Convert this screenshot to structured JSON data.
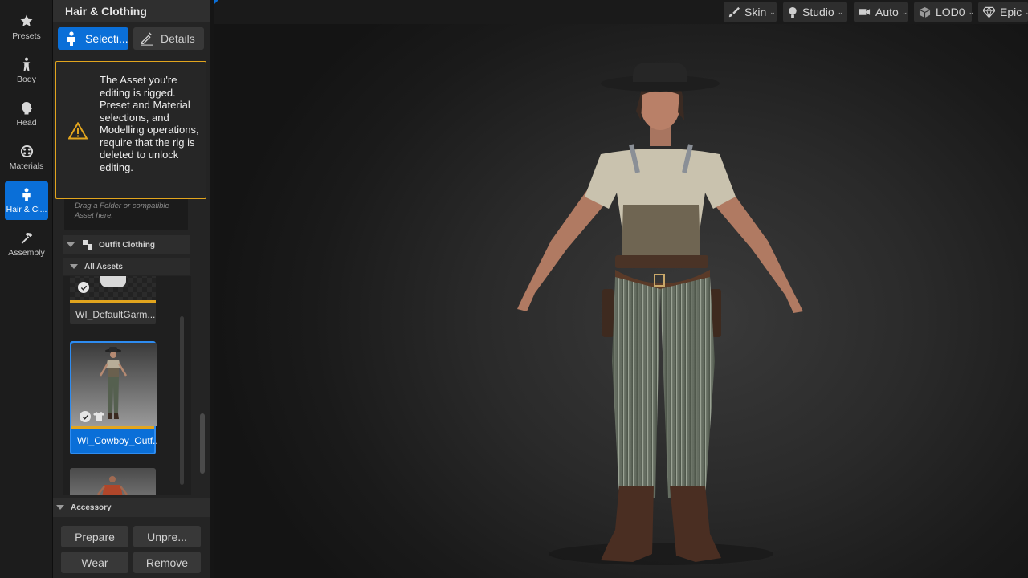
{
  "rail": {
    "items": [
      {
        "label": "Presets",
        "icon": "star-icon"
      },
      {
        "label": "Body",
        "icon": "body-icon"
      },
      {
        "label": "Head",
        "icon": "head-icon"
      },
      {
        "label": "Materials",
        "icon": "materials-icon"
      },
      {
        "label": "Hair & Cl...",
        "icon": "hair-clothing-icon",
        "active": true
      },
      {
        "label": "Assembly",
        "icon": "hammer-icon"
      }
    ]
  },
  "panel": {
    "title": "Hair & Clothing",
    "tabs": {
      "selection": "Selecti...",
      "details": "Details"
    },
    "dropzone_hint": "Drag a Folder or compatible Asset here.",
    "outfit_section": "Outfit Clothing",
    "all_assets": "All Assets",
    "assets": [
      {
        "name": "WI_DefaultGarm..."
      },
      {
        "name": "WI_Cowboy_Outf...",
        "selected": true
      },
      {
        "name": ""
      }
    ],
    "accessory_section": "Accessory",
    "buttons": {
      "prepare": "Prepare",
      "unprepare": "Unpre...",
      "wear": "Wear",
      "remove": "Remove"
    }
  },
  "warning": {
    "text": "The Asset you're editing is rigged. Preset and Material selections, and Modelling operations, require that the rig is deleted to unlock editing.",
    "color": "#e2a51e"
  },
  "viewport_toolbar": {
    "skin": "Skin",
    "studio": "Studio",
    "auto": "Auto",
    "lod": "LOD0",
    "quality": "Epic"
  },
  "colors": {
    "accent": "#0a6fd8",
    "warning": "#e2a51e"
  }
}
